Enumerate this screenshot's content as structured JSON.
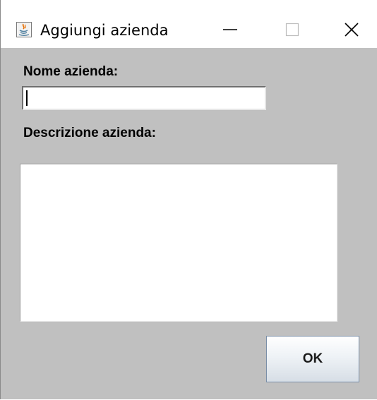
{
  "window": {
    "title": "Aggiungi azienda",
    "app_icon": "java-icon",
    "controls": {
      "minimize_icon": "minimize-icon",
      "maximize_icon": "maximize-icon",
      "close_icon": "close-icon"
    }
  },
  "form": {
    "name_label": "Nome azienda:",
    "name_value": "",
    "description_label": "Descrizione azienda:",
    "description_value": "",
    "ok_label": "OK"
  },
  "colors": {
    "panel_background": "#c0c0c0",
    "titlebar_background": "#ffffff",
    "field_background": "#ffffff"
  }
}
